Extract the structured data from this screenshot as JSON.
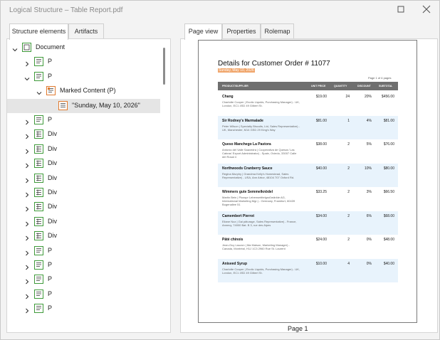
{
  "window": {
    "title": "Logical Structure – Table Report.pdf"
  },
  "left_tabs": [
    {
      "label": "Structure elements",
      "active": true
    },
    {
      "label": "Artifacts",
      "active": false
    }
  ],
  "right_tabs": [
    {
      "label": "Page view",
      "active": true
    },
    {
      "label": "Properties",
      "active": false
    },
    {
      "label": "Rolemap",
      "active": false
    }
  ],
  "tree": [
    {
      "label": "Document",
      "icon": "document-icon",
      "expanded": true
    },
    {
      "label": "P",
      "icon": "paragraph-icon",
      "expanded": false
    },
    {
      "label": "P",
      "icon": "paragraph-icon",
      "expanded": true
    },
    {
      "label": "Marked Content (P)",
      "icon": "marked-content-icon",
      "expanded": true
    },
    {
      "label": "\"Sunday, May 10, 2026\"",
      "icon": "text-content-icon",
      "selected": true
    },
    {
      "label": "P",
      "icon": "paragraph-icon"
    },
    {
      "label": "Div",
      "icon": "div-icon"
    },
    {
      "label": "Div",
      "icon": "div-icon"
    },
    {
      "label": "Div",
      "icon": "div-icon"
    },
    {
      "label": "Div",
      "icon": "div-icon"
    },
    {
      "label": "Div",
      "icon": "div-icon"
    },
    {
      "label": "Div",
      "icon": "div-icon"
    },
    {
      "label": "Div",
      "icon": "div-icon"
    },
    {
      "label": "Div",
      "icon": "div-icon"
    },
    {
      "label": "P",
      "icon": "paragraph-icon"
    },
    {
      "label": "P",
      "icon": "paragraph-icon"
    },
    {
      "label": "P",
      "icon": "paragraph-icon"
    },
    {
      "label": "P",
      "icon": "paragraph-icon"
    },
    {
      "label": "P",
      "icon": "paragraph-icon"
    }
  ],
  "preview": {
    "title": "Details for Customer Order # 11077",
    "date": "Sunday, May 10, 2026",
    "page_of": "Page 1 of 4 pages",
    "page_label": "Page 1",
    "columns": [
      "PRODUCT/SUPPLIER",
      "UNIT PRICE",
      "QUANTITY",
      "DISCOUNT",
      "SUBTOTAL"
    ],
    "rows": [
      {
        "product": "Chang",
        "supplier": "Charlotte Cooper | Exotic Liquids, Purchasing Manager) - UK, London, EC1 4SD 49 Gilbert St.",
        "price": "$19.00",
        "qty": "24",
        "disc": "20%",
        "subtotal": "$456.00"
      },
      {
        "product": "Sir Rodney's Marmalade",
        "supplier": "Peter Wilson | Specialty Biscuits, Ltd, Sales Representative) - UK, Manchester, M14 GSD 29 King's Way",
        "price": "$81.00",
        "qty": "1",
        "disc": "4%",
        "subtotal": "$81.00"
      },
      {
        "product": "Queso Manchego La Pastora",
        "supplier": "Antonio del Valle Saavedra | Cooperativa de Quesos 'Las Cabras' Export Administrator) - Spain, Oviedo, 33007 Calle del Rosal 4",
        "price": "$38.00",
        "qty": "2",
        "disc": "5%",
        "subtotal": "$76.00"
      },
      {
        "product": "Northwoods Cranberry Sauce",
        "supplier": "Regina Murphy | Grandma Kelly's Homestead, Sales Representative) - USA, Ann Arbor, 48104 707 Oxford Rd.",
        "price": "$40.00",
        "qty": "2",
        "disc": "10%",
        "subtotal": "$80.00"
      },
      {
        "product": "Wimmers gute Semmelknödel",
        "supplier": "Martin Bein | Plusspr Lebensmittelgroßmärkte AG, International Marketing Mgr.) - Germany, Frankfurt, 60439 Bogenallee 51",
        "price": "$33.25",
        "qty": "2",
        "disc": "3%",
        "subtotal": "$66.50"
      },
      {
        "product": "Camembert Pierrot",
        "supplier": "Eliane Noz | Gai pâturage, Sales Representative) - France, Annecy, 74000 Bat. B 3, rue des Alpes",
        "price": "$34.00",
        "qty": "2",
        "disc": "6%",
        "subtotal": "$68.00"
      },
      {
        "product": "Pâté chinois",
        "supplier": "Jean-Guy Lauzon | Ma Maison, Marketing Manager) - Canada, Montréal, H1J 1C3 2960 Rue St. Laurent",
        "price": "$24.00",
        "qty": "2",
        "disc": "0%",
        "subtotal": "$48.00"
      },
      {
        "product": "Aniseed Syrup",
        "supplier": "Charlotte Cooper | Exotic Liquids, Purchasing Manager) - UK, London, EC1 4SD 49 Gilbert St.",
        "price": "$10.00",
        "qty": "4",
        "disc": "0%",
        "subtotal": "$40.00"
      }
    ]
  },
  "colors": {
    "icon_green": "#3f9a3a",
    "icon_orange": "#e07a2e",
    "row_alt": "#e8f3fc",
    "header_gray": "#6f6f6f"
  }
}
